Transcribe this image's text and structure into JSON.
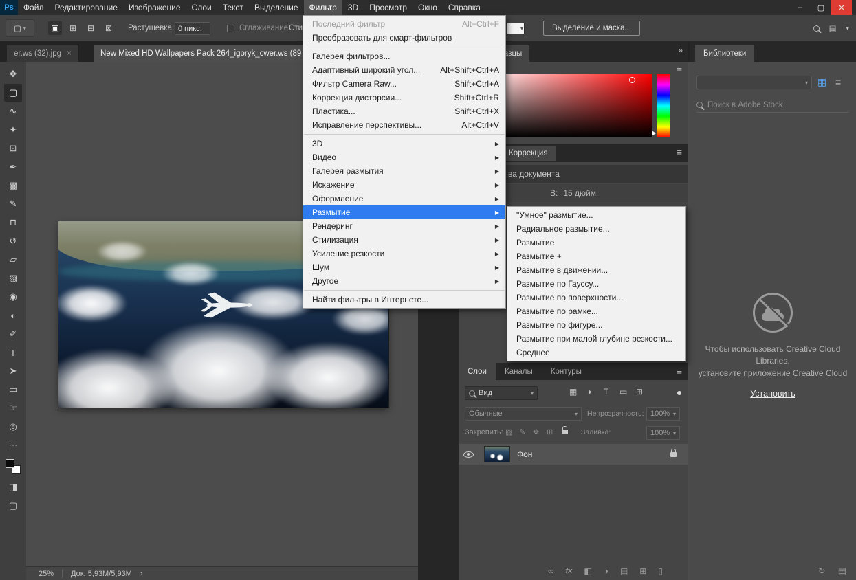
{
  "window": {
    "logo": "Ps",
    "controls": {
      "minimize": "–",
      "maximize": "▢",
      "close": "✕"
    }
  },
  "menubar": {
    "items": [
      "Файл",
      "Редактирование",
      "Изображение",
      "Слои",
      "Текст",
      "Выделение",
      "Фильтр",
      "3D",
      "Просмотр",
      "Окно",
      "Справка"
    ]
  },
  "options_bar": {
    "tool_icon": "▢",
    "selection_modes": [
      "▣",
      "⊞",
      "⊟",
      "⊠"
    ],
    "feather_label": "Растушевка:",
    "feather_value": "0 пикс.",
    "smoothing_label": "Сглаживание",
    "style_label": "Сти",
    "select_and_mask": "Выделение и маска..."
  },
  "tabs": {
    "tab1": "er.ws (32).jpg",
    "tab1_close": "×",
    "tab2": "New Mixed HD Wallpapers Pack 264_igoryk_cwer.ws (89"
  },
  "toolbar": {
    "tools": [
      {
        "name": "move",
        "glyph": "✥"
      },
      {
        "name": "marquee",
        "glyph": "▢"
      },
      {
        "name": "lasso",
        "glyph": "∿"
      },
      {
        "name": "quick-selection",
        "glyph": "✦"
      },
      {
        "name": "crop",
        "glyph": "⊡"
      },
      {
        "name": "eyedropper",
        "glyph": "✒"
      },
      {
        "name": "healing-brush",
        "glyph": "▩"
      },
      {
        "name": "brush",
        "glyph": "✎"
      },
      {
        "name": "clone-stamp",
        "glyph": "⊓"
      },
      {
        "name": "history-brush",
        "glyph": "↺"
      },
      {
        "name": "eraser",
        "glyph": "▱"
      },
      {
        "name": "gradient",
        "glyph": "▨"
      },
      {
        "name": "blur",
        "glyph": "◉"
      },
      {
        "name": "dodge",
        "glyph": "◐"
      },
      {
        "name": "pen",
        "glyph": "✐"
      },
      {
        "name": "type",
        "glyph": "T"
      },
      {
        "name": "path-selection",
        "glyph": "➤"
      },
      {
        "name": "shape",
        "glyph": "▭"
      },
      {
        "name": "hand",
        "glyph": "☞"
      },
      {
        "name": "zoom",
        "glyph": "◎"
      }
    ],
    "more": "⋯",
    "quick_mask": "◨",
    "screen_mode": "▢"
  },
  "filter_menu": {
    "items": [
      {
        "label": "Последний фильтр",
        "shortcut": "Alt+Ctrl+F"
      },
      {
        "label": "Преобразовать для смарт-фильтров"
      },
      {
        "label": "Галерея фильтров..."
      },
      {
        "label": "Адаптивный широкий угол...",
        "shortcut": "Alt+Shift+Ctrl+A"
      },
      {
        "label": "Фильтр Camera Raw...",
        "shortcut": "Shift+Ctrl+A"
      },
      {
        "label": "Коррекция дисторсии...",
        "shortcut": "Shift+Ctrl+R"
      },
      {
        "label": "Пластика...",
        "shortcut": "Shift+Ctrl+X"
      },
      {
        "label": "Исправление перспективы...",
        "shortcut": "Alt+Ctrl+V"
      },
      {
        "label": "3D"
      },
      {
        "label": "Видео"
      },
      {
        "label": "Галерея размытия"
      },
      {
        "label": "Искажение"
      },
      {
        "label": "Оформление"
      },
      {
        "label": "Размытие"
      },
      {
        "label": "Рендеринг"
      },
      {
        "label": "Стилизация"
      },
      {
        "label": "Усиление резкости"
      },
      {
        "label": "Шум"
      },
      {
        "label": "Другое"
      },
      {
        "label": "Найти фильтры в Интернете..."
      }
    ]
  },
  "blur_submenu": {
    "items": [
      "\"Умное\" размытие...",
      "Радиальное размытие...",
      "Размытие",
      "Размытие +",
      "Размытие в движении...",
      "Размытие по Гауссу...",
      "Размытие по поверхности...",
      "Размытие по рамке...",
      "Размытие по фигуре...",
      "Размытие при малой глубине резкости...",
      "Среднее"
    ]
  },
  "swatches_panel": {
    "tab": "Образцы"
  },
  "adjustments_panel": {
    "tab": "Коррекция",
    "doc_row": "ва документа",
    "height_label": "В:",
    "height_value": "15 дюйм"
  },
  "layers_panel": {
    "tabs": [
      "Слои",
      "Каналы",
      "Контуры"
    ],
    "view_filter": "Вид",
    "filter_icons": [
      "▦",
      "◑",
      "T",
      "▭",
      "⊞"
    ],
    "blend_mode": "Обычные",
    "opacity_label": "Непрозрачность:",
    "opacity_value": "100%",
    "lock_label": "Закрепить:",
    "lock_icons": [
      "▨",
      "✎",
      "✥",
      "⊞"
    ],
    "fill_label": "Заливка:",
    "fill_value": "100%",
    "layer_name": "Фон",
    "bottom_icons": {
      "link": "∞",
      "fx": "fx",
      "mask": "◧",
      "adjustment": "◑",
      "group": "▤",
      "new_layer": "⊞",
      "trash": "▯"
    }
  },
  "libraries_panel": {
    "tab": "Библиотеки",
    "search_placeholder": "Поиск в Adobe Stock",
    "message_line1": "Чтобы использовать Creative Cloud",
    "message_line2": "Libraries,",
    "message_line3": "установите приложение Creative Cloud",
    "install_link": "Установить",
    "grid_icon": "▦",
    "list_icon": "≡"
  },
  "status_bar": {
    "zoom": "25%",
    "doc_size": "Док: 5,93М/5,93М",
    "chevron": "›"
  },
  "icons": {
    "submenu_arrow": "▶",
    "dropdown": "▾",
    "panel_menu": "≡",
    "collapse_right": "»",
    "sync": "↻",
    "workspace": "▤"
  },
  "colors": {
    "menu_highlight": "#2e7cf0",
    "accent_blue": "#57a5f2",
    "close_red": "#e03c34"
  }
}
